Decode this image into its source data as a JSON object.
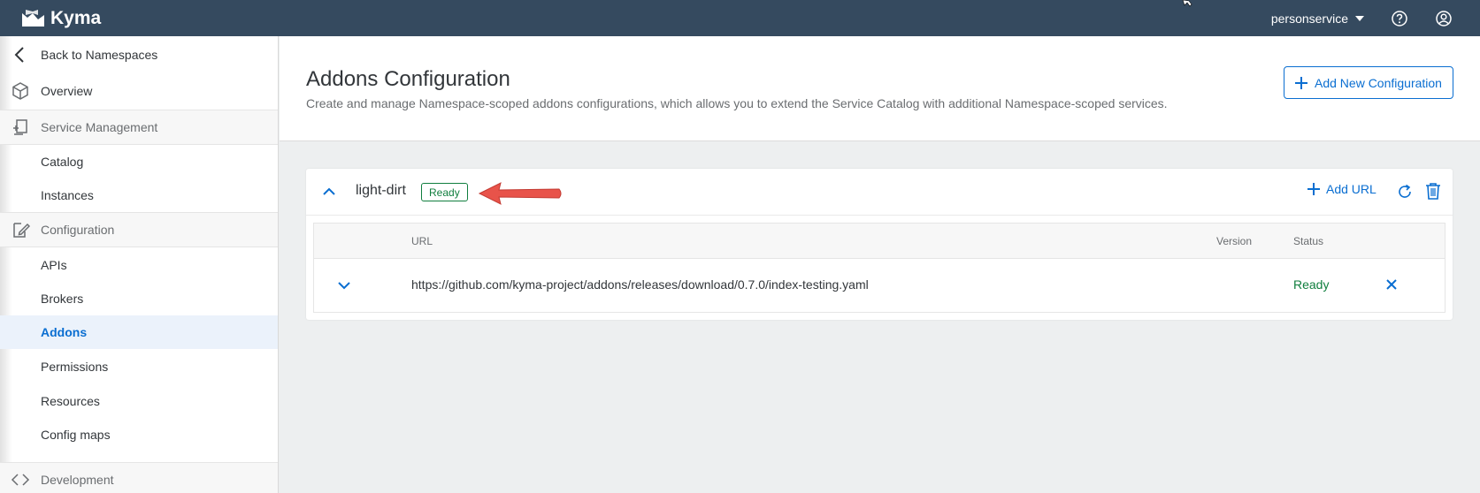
{
  "shell": {
    "brand": "Kyma",
    "namespace": "personservice"
  },
  "sidebar": {
    "back": "Back to Namespaces",
    "overview": "Overview",
    "groups": [
      {
        "label": "Service Management",
        "items": [
          "Catalog",
          "Instances"
        ]
      },
      {
        "label": "Configuration",
        "items": [
          "APIs",
          "Brokers",
          "Addons",
          "Permissions",
          "Resources",
          "Config maps"
        ]
      },
      {
        "label": "Development",
        "items": []
      }
    ],
    "active_item": "Addons"
  },
  "page": {
    "title": "Addons Configuration",
    "description": "Create and manage Namespace-scoped addons configurations, which allows you to extend the Service Catalog with additional Namespace-scoped services.",
    "add_button": "Add New Configuration"
  },
  "config": {
    "name": "light-dirt",
    "status": "Ready",
    "add_url": "Add URL",
    "table": {
      "headers": [
        "URL",
        "Version",
        "Status"
      ],
      "rows": [
        {
          "url": "https://github.com/kyma-project/addons/releases/download/0.7.0/index-testing.yaml",
          "version": "",
          "status": "Ready"
        }
      ]
    }
  },
  "colors": {
    "shell": "#354a5f",
    "accent": "#0a6ed1",
    "positive": "#107e3e",
    "annotation_arrow": "#e8534a"
  }
}
